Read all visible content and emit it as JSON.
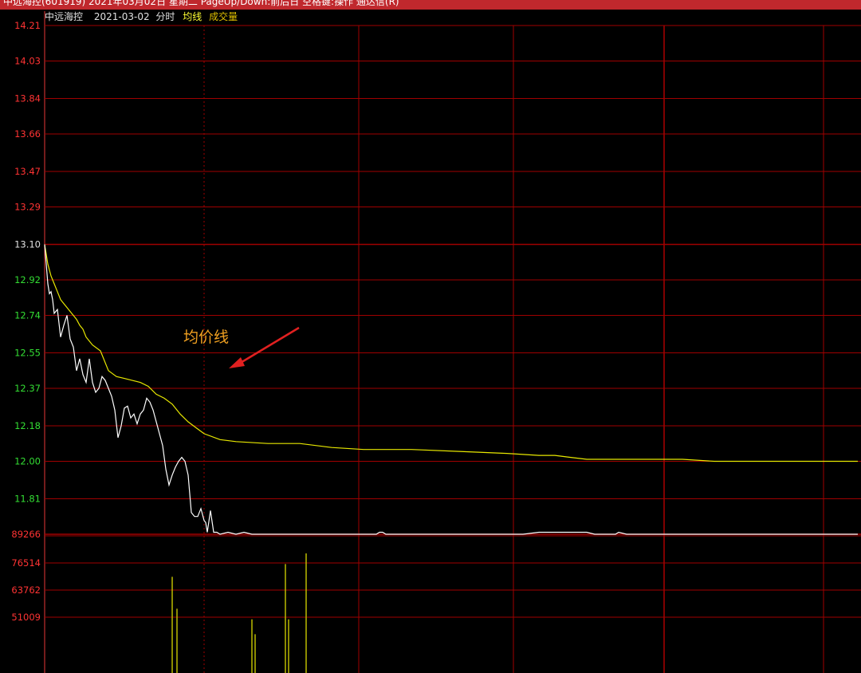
{
  "window_title": "中远海控(601919) 2021年03月02日 星期二 PageUp/Down:前后日 空格键:操作 通达信(R)",
  "header": {
    "stock": "中远海控",
    "date": "2021-03-02",
    "mode": "分时",
    "avg_label": "均线",
    "vol_label": "成交量"
  },
  "annotation": {
    "text": "均价线",
    "color": "#f0a020",
    "arrow_color": "#e02020"
  },
  "colors": {
    "grid": "#a00000",
    "price_line": "#ffffff",
    "avg_line": "#e8e800",
    "volume_bar": "#c8c800",
    "label_up": "#ff3333",
    "label_flat": "#e0e0e0",
    "label_down": "#33dd33",
    "volume_label": "#ff3333"
  },
  "chart_data": {
    "type": "line",
    "title": "",
    "xlabel": "",
    "ylabel": "",
    "prev_close": 13.1,
    "price_ylim": [
      11.63,
      14.21
    ],
    "price_ticks": [
      "14.21",
      "14.03",
      "13.84",
      "13.66",
      "13.47",
      "13.29",
      "13.10",
      "12.92",
      "12.74",
      "12.55",
      "12.37",
      "12.18",
      "12.00",
      "11.81"
    ],
    "volume_ylim": [
      38257,
      89266
    ],
    "volume_ticks": [
      "89266",
      "76514",
      "63762",
      "51009"
    ],
    "grid": true,
    "series": [
      {
        "key": "price",
        "x": [
          0,
          1,
          2,
          3,
          4,
          5,
          6,
          8,
          10,
          12,
          14,
          15,
          16,
          18,
          20,
          22,
          24,
          26,
          28,
          30,
          32,
          34,
          36,
          38,
          40,
          41,
          42,
          44,
          46,
          48,
          50,
          52,
          54,
          56,
          58,
          60,
          61,
          62,
          64,
          66,
          68,
          70,
          72,
          74,
          76,
          78,
          80,
          82,
          84,
          86,
          88,
          90,
          92,
          94,
          96,
          98,
          100,
          101,
          102,
          104,
          106,
          108,
          110,
          115,
          120,
          125,
          130,
          140,
          150,
          160,
          170,
          180,
          190,
          200,
          208,
          210,
          212,
          214,
          216,
          220,
          240,
          260,
          300,
          310,
          320,
          330,
          340,
          345,
          350,
          352,
          355,
          358,
          360,
          365,
          370,
          375,
          380,
          385,
          390,
          392,
          395,
          400,
          450,
          480,
          510
        ],
        "values": [
          13.1,
          13.0,
          12.9,
          12.85,
          12.86,
          12.82,
          12.75,
          12.77,
          12.63,
          12.69,
          12.74,
          12.68,
          12.62,
          12.58,
          12.46,
          12.52,
          12.44,
          12.4,
          12.52,
          12.4,
          12.35,
          12.37,
          12.43,
          12.41,
          12.37,
          12.35,
          12.33,
          12.26,
          12.12,
          12.18,
          12.27,
          12.28,
          12.22,
          12.24,
          12.19,
          12.24,
          12.25,
          12.26,
          12.32,
          12.3,
          12.26,
          12.2,
          12.14,
          12.08,
          11.96,
          11.88,
          11.93,
          11.97,
          12.0,
          12.02,
          12.0,
          11.93,
          11.74,
          11.72,
          11.72,
          11.76,
          11.7,
          11.69,
          11.64,
          11.75,
          11.64,
          11.64,
          11.63,
          11.64,
          11.63,
          11.64,
          11.63,
          11.63,
          11.63,
          11.63,
          11.63,
          11.63,
          11.63,
          11.63,
          11.63,
          11.64,
          11.64,
          11.63,
          11.63,
          11.63,
          11.63,
          11.63,
          11.63,
          11.64,
          11.64,
          11.64,
          11.64,
          11.63,
          11.63,
          11.63,
          11.63,
          11.63,
          11.64,
          11.63,
          11.63,
          11.63,
          11.63,
          11.63,
          11.63,
          11.63,
          11.63,
          11.63,
          11.63,
          11.63,
          11.63
        ]
      },
      {
        "key": "avg",
        "x": [
          0,
          2,
          4,
          6,
          8,
          10,
          12,
          14,
          16,
          18,
          20,
          22,
          24,
          26,
          30,
          35,
          40,
          45,
          50,
          55,
          60,
          65,
          70,
          75,
          80,
          85,
          90,
          95,
          100,
          110,
          120,
          140,
          160,
          180,
          200,
          230,
          260,
          290,
          310,
          320,
          330,
          340,
          350,
          360,
          380,
          400,
          420,
          460,
          480,
          510
        ],
        "values": [
          13.1,
          13.0,
          12.94,
          12.9,
          12.86,
          12.82,
          12.8,
          12.78,
          12.76,
          12.74,
          12.72,
          12.69,
          12.67,
          12.63,
          12.59,
          12.56,
          12.46,
          12.43,
          12.42,
          12.41,
          12.4,
          12.38,
          12.34,
          12.32,
          12.29,
          12.24,
          12.2,
          12.17,
          12.14,
          12.11,
          12.1,
          12.09,
          12.09,
          12.07,
          12.06,
          12.06,
          12.05,
          12.04,
          12.03,
          12.03,
          12.02,
          12.01,
          12.01,
          12.01,
          12.01,
          12.01,
          12.0,
          12.0,
          12.0,
          12.0
        ]
      }
    ],
    "volume": {
      "x": [
        80,
        83,
        130,
        132,
        151,
        153,
        164
      ],
      "values": [
        70000,
        55000,
        50000,
        43000,
        76000,
        50000,
        81000
      ]
    }
  }
}
